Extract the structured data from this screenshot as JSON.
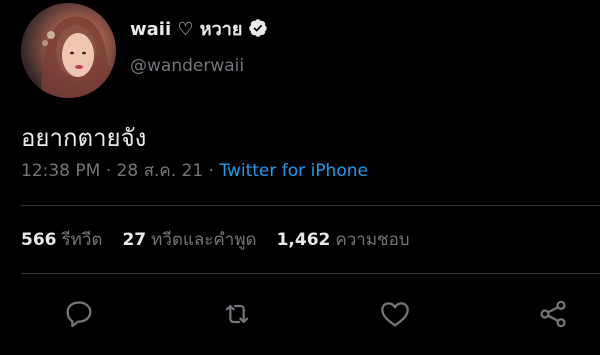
{
  "author": {
    "display_name": "waii ♡ หวาย",
    "handle": "@wanderwaii"
  },
  "tweet": {
    "text": "อยากตายจัง",
    "time": "12:38 PM",
    "separator1": " · ",
    "date": "28 ส.ค. 21",
    "separator2": " · ",
    "source": "Twitter for iPhone"
  },
  "stats": {
    "retweets_count": "566",
    "retweets_label": "รีทวีต",
    "quotes_count": "27",
    "quotes_label": "ทวีตและคำพูด",
    "likes_count": "1,462",
    "likes_label": "ความชอบ"
  },
  "icons": {
    "reply": "reply-icon",
    "retweet": "retweet-icon",
    "like": "heart-icon",
    "share": "share-icon",
    "verified": "verified-badge-icon"
  },
  "colors": {
    "background": "#000000",
    "text": "#e7e9ea",
    "secondary": "#71767b",
    "accent": "#1d9bf0",
    "divider": "#2f3336"
  }
}
